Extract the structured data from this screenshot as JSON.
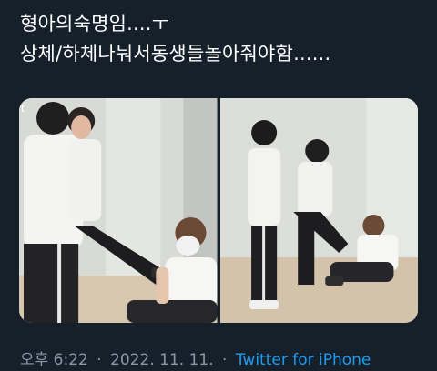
{
  "tweet": {
    "lines": [
      "형아의숙명임....ㅜ",
      "상체/하체나눠서동생들놀아줘야함......"
    ],
    "media": [
      {
        "alt": "photo-1",
        "watermark": "t"
      },
      {
        "alt": "photo-2"
      }
    ],
    "meta": {
      "time": "오후 6:22",
      "separator": "·",
      "date": "2022. 11. 11.",
      "source": "Twitter for iPhone"
    }
  },
  "colors": {
    "background": "#15202b",
    "text": "#ffffff",
    "secondary_text": "#8b98a5",
    "link": "#1d9bf0"
  }
}
